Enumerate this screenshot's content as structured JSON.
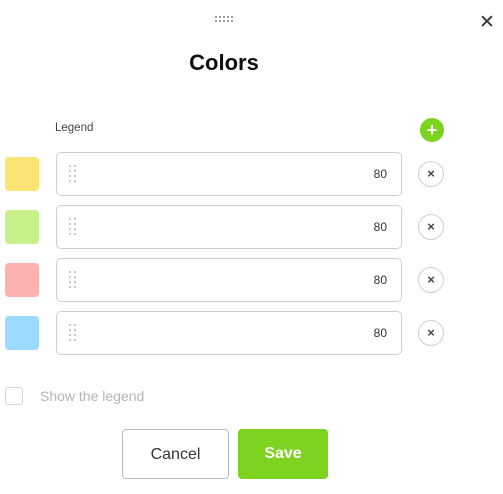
{
  "dialog": {
    "title": "Colors",
    "close_icon": "close-icon",
    "drag_handle_icon": "drag-handle-icon"
  },
  "legend": {
    "label": "Legend",
    "add_icon": "plus-icon",
    "add_symbol": "+",
    "remove_symbol": "×",
    "rows": [
      {
        "color": "#fde274",
        "value": "80"
      },
      {
        "color": "#c8f08a",
        "value": "80"
      },
      {
        "color": "#ffb0b0",
        "value": "80"
      },
      {
        "color": "#9ddaff",
        "value": "80"
      }
    ]
  },
  "show_legend": {
    "label": "Show the legend",
    "checked": false
  },
  "buttons": {
    "cancel": "Cancel",
    "save": "Save"
  },
  "colors": {
    "accent": "#7ed321",
    "border": "#cfcfcf"
  }
}
